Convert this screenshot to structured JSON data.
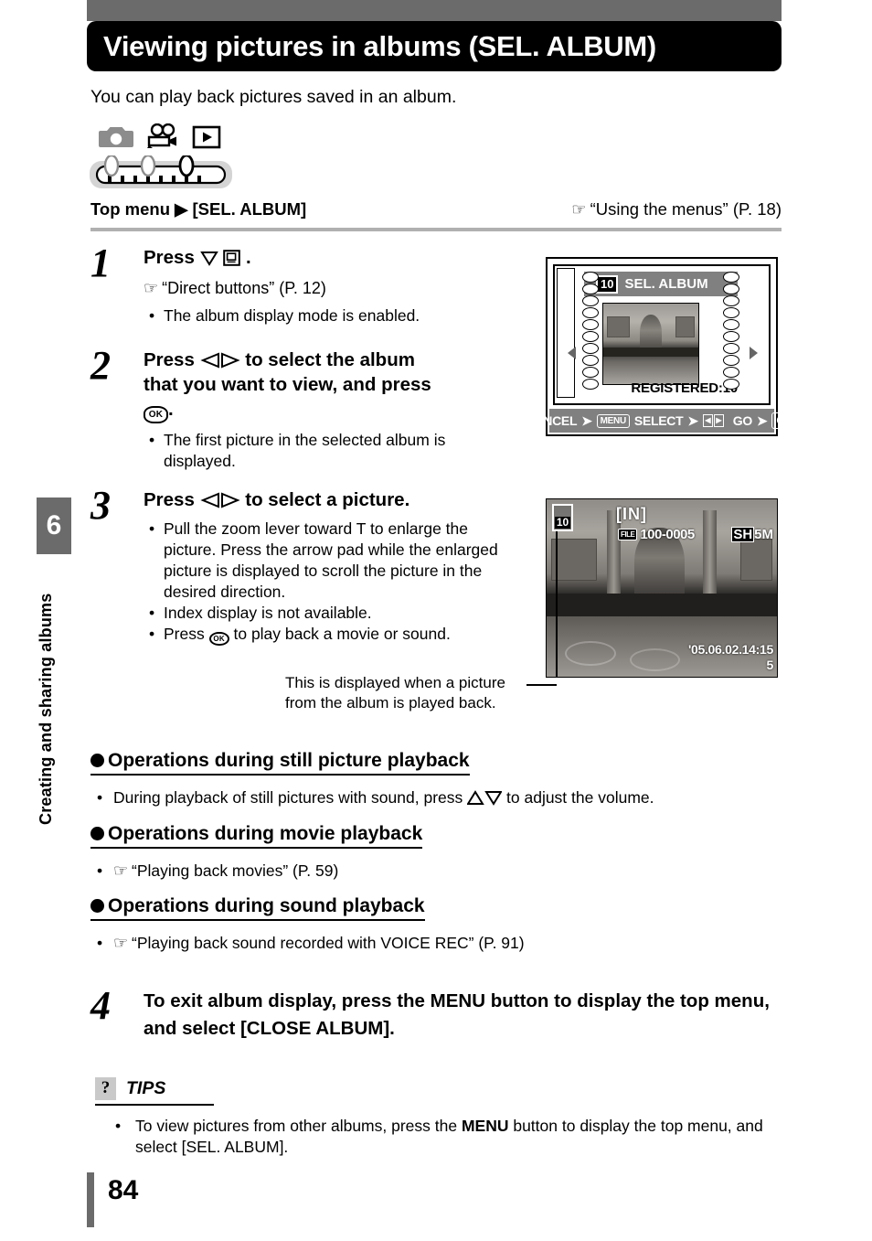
{
  "header": {
    "title": "Viewing pictures in albums (SEL. ALBUM)",
    "intro": "You can play back pictures saved in an album.",
    "mode_icons": [
      "still-camera-icon",
      "movie-camera-icon",
      "playback-icon",
      "mode-dial-icon"
    ],
    "top_menu_path": "Top menu ▶ [SEL. ALBUM]",
    "reference": "“Using the menus” (P. 18)",
    "reference_hand": "pointing-hand-icon"
  },
  "sidebar": {
    "chapter_number": "6",
    "chapter_title": "Creating and sharing albums"
  },
  "steps": [
    {
      "number": "1",
      "heading_before": "Press",
      "heading_after": ".",
      "reference": "“Direct buttons” (P. 12)",
      "bullets": [
        "The album display mode is enabled."
      ]
    },
    {
      "number": "2",
      "heading_line1_before": "Press",
      "heading_line1_after": "to select the album",
      "heading_line2": "that you want to view, and press",
      "heading_line3_after": ".",
      "bullets": [
        "The first picture in the selected album is displayed."
      ]
    },
    {
      "number": "3",
      "heading_before": "Press",
      "heading_after": "to select a picture.",
      "bullets": [
        "Pull the zoom lever toward T to enlarge the picture. Press the arrow pad while the enlarged picture is displayed to scroll the picture in the desired direction.",
        "Index display is not available.",
        "Press  to play back a movie or sound."
      ],
      "bullet3_before": "Press",
      "bullet3_after": "to play back a movie or sound."
    },
    {
      "number": "4",
      "text": "To exit album display, press the MENU button to display the top menu, and select [CLOSE ALBUM]."
    }
  ],
  "callout": "This is displayed when a picture from the album is played back.",
  "lcd_album_select": {
    "badge": "10",
    "title": "SEL. ALBUM",
    "registered_label": "REGISTERED:10",
    "bar": {
      "cancel_label": "CANCEL",
      "cancel_key": "MENU",
      "select_label": "SELECT",
      "select_key": "left-right-arrow-keys",
      "go_label": "GO",
      "go_key": "OK"
    },
    "left_arrow": "left-triangle-icon",
    "right_arrow": "right-triangle-icon"
  },
  "lcd_playback": {
    "album_badge": "10",
    "memory": "[IN]",
    "file_tag": "FILE",
    "file_number": "100-0005",
    "quality_sh": "SH",
    "resolution": "5M",
    "date_line1": "'05.06.02.14:15",
    "date_line2": "5"
  },
  "sections": [
    {
      "heading": "Operations during still picture playback",
      "bullet_before": "During playback of still pictures with sound, press",
      "bullet_after": "to adjust the volume."
    },
    {
      "heading": "Operations during movie playback",
      "bullet_reference": "“Playing back movies” (P. 59)"
    },
    {
      "heading": "Operations during sound playback",
      "bullet_reference": "“Playing back sound recorded with VOICE REC” (P. 91)"
    }
  ],
  "tips": {
    "label": "TIPS",
    "icon": "question-mark-icon",
    "bullet_part1": "To view pictures from other albums, press the ",
    "bullet_menu": "MENU",
    "bullet_part2": " button to display the top menu, and select [SEL. ALBUM]."
  },
  "footer": {
    "page_number": "84"
  }
}
